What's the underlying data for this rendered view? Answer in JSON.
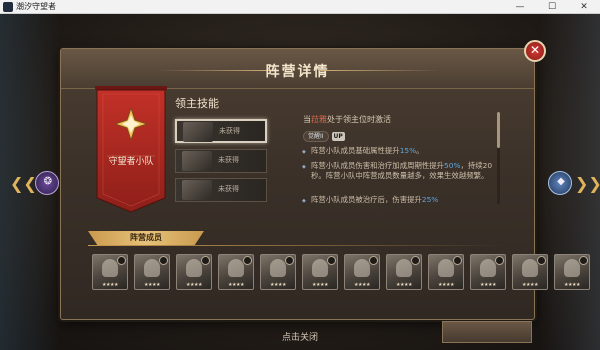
{
  "window": {
    "title": "潮汐守望者",
    "minimize_glyph": "—",
    "maximize_glyph": "☐",
    "close_glyph": "✕"
  },
  "panel": {
    "title": "阵营详情",
    "close_glyph": "✕"
  },
  "faction": {
    "name": "守望者小队",
    "banner_color": "#b52e26"
  },
  "leader_skill": {
    "title": "领主技能",
    "slots": [
      {
        "status": "未获得",
        "active": true
      },
      {
        "status": "未获得",
        "active": false
      },
      {
        "status": "未获得",
        "active": false
      }
    ]
  },
  "detail": {
    "head_prefix": "当",
    "head_highlight": "菈雅",
    "head_suffix": "处于领主位时激活",
    "awaken_label": "觉醒II",
    "awaken_up": "UP",
    "bullets": [
      {
        "pre": "阵营小队成员基础属性提升",
        "value": "15%",
        "post": "。"
      },
      {
        "pre": "阵营小队成员伤害和治疗加成周期性提升",
        "value": "50%",
        "post": "，持续20秒。阵营小队中阵营成员数量越多，效果生效越频繁。"
      },
      {
        "pre": "阵营小队成员被治疗后，伤害提升",
        "value": "25%",
        "post": ""
      }
    ]
  },
  "members": {
    "label": "阵营成员",
    "count": 12,
    "stars": "★★★★"
  },
  "navigation": {
    "left_chevron": "❮❮",
    "right_chevron": "❯❯",
    "left_orb_glyph": "❂",
    "right_orb_glyph": "◆"
  },
  "footer": {
    "hint": "点击关闭"
  },
  "colors": {
    "accent_gold": "#e0b45c",
    "highlight_red": "#e06a4a",
    "value_blue": "#5aa7e0"
  }
}
